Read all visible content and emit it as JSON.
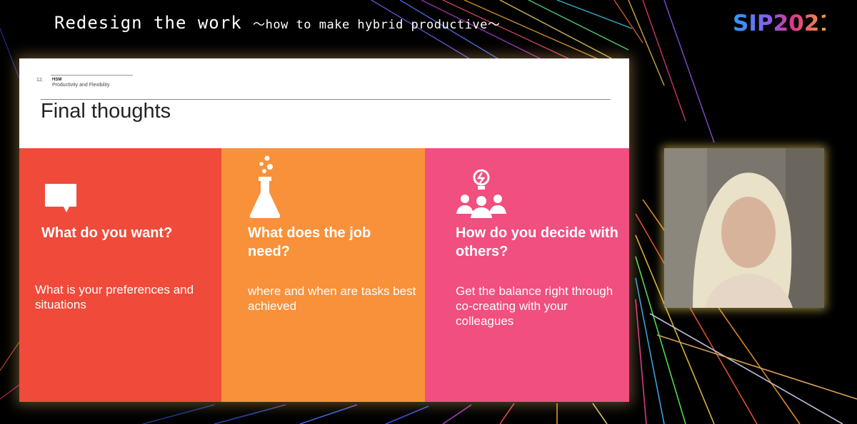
{
  "header": {
    "title": "Redesign the work",
    "subtitle": "～how to make hybrid productive～"
  },
  "logo": {
    "text": "SIP2021",
    "colors": [
      "#2a9df4",
      "#e0388a",
      "#f0c020"
    ]
  },
  "slide": {
    "number": "12.",
    "brand": "HSM",
    "section": "Productivity and Flexibility",
    "title": "Final thoughts",
    "columns": [
      {
        "icon": "speech-bubble-icon",
        "heading": "What do you want?",
        "body": "What is your preferences and situations",
        "color": "#f04a3a"
      },
      {
        "icon": "flask-icon",
        "heading": "What does the job need?",
        "body": "where and when are tasks best achieved",
        "color": "#f8913a"
      },
      {
        "icon": "team-idea-icon",
        "heading": "How do you decide with others?",
        "body": "Get the balance right through co-creating with your colleagues",
        "color": "#f04f80"
      }
    ]
  },
  "video": {
    "subject": "presenter-webcam"
  }
}
